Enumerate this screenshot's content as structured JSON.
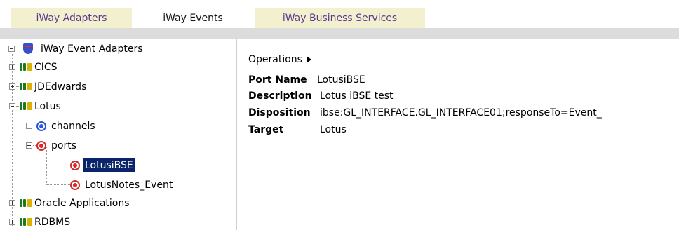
{
  "tabs": [
    {
      "label": "iWay Adapters",
      "active": false
    },
    {
      "label": "iWay Events",
      "active": true
    },
    {
      "label": "iWay Business Services",
      "active": false
    }
  ],
  "tree": {
    "root": "iWay Event Adapters",
    "items": {
      "cics": "CICS",
      "jdedwards": "JDEdwards",
      "lotus": "Lotus",
      "channels": "channels",
      "ports": "ports",
      "lotusibse": "LotusiBSE",
      "lotusnotes_event": "LotusNotes_Event",
      "oracle": "Oracle Applications",
      "rdbms": "RDBMS"
    }
  },
  "details": {
    "operations_label": "Operations",
    "fields": {
      "port_name": {
        "key": "Port Name",
        "value": "LotusiBSE"
      },
      "description": {
        "key": "Description",
        "value": "Lotus iBSE test"
      },
      "disposition": {
        "key": "Disposition",
        "value": "ibse:GL_INTERFACE.GL_INTERFACE01;responseTo=Event_"
      },
      "target": {
        "key": "Target",
        "value": "Lotus"
      }
    }
  },
  "colors": {
    "selection": "#0a246a",
    "inactive_tab": "#f3f0cf",
    "tab_link": "#5a3a8e",
    "header_bar": "#dcdcdc"
  }
}
